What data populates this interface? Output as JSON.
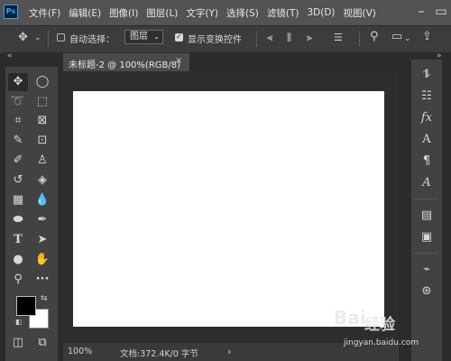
{
  "app": {
    "logo": "Ps"
  },
  "menu": [
    "文件(F)",
    "编辑(E)",
    "图像(I)",
    "图层(L)",
    "文字(Y)",
    "选择(S)",
    "滤镜(T)",
    "3D(D)",
    "视图(V)"
  ],
  "window_controls": {
    "minimize": "–",
    "restore": "▭"
  },
  "options_bar": {
    "auto_select_label": "自动选择：",
    "auto_select_checked": false,
    "target_value": "图层",
    "show_transform_label": "显示变换控件",
    "show_transform_checked": true
  },
  "document_tab": {
    "title": "未标题-2 @ 100%(RGB/8)",
    "close": "×"
  },
  "status_bar": {
    "zoom": "100%",
    "doc_info": "文档:372.4K/0 字节",
    "arrow": "›"
  },
  "foreground_color": "#000000",
  "background_color": "#ffffff",
  "watermark": {
    "logo": "Bai",
    "text": "经验",
    "url": "jingyan.baidu.com"
  },
  "panel_toggle": {
    "left": "«",
    "right": "»"
  }
}
